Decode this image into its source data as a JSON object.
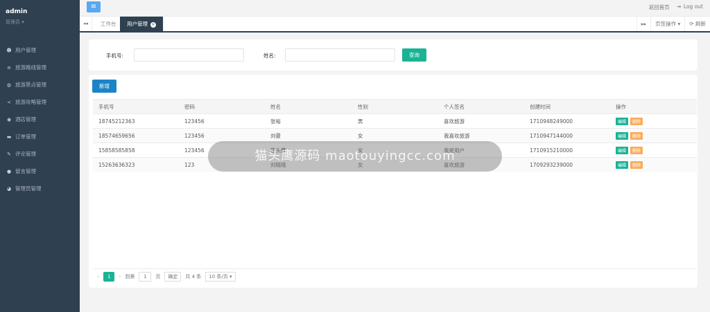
{
  "profile": {
    "name": "admin",
    "role": "管理员 ▾"
  },
  "sidebar": {
    "items": [
      {
        "label": "用户管理",
        "icon": "☻"
      },
      {
        "label": "旅游路线管理",
        "icon": "≡"
      },
      {
        "label": "旅游景点管理",
        "icon": "◍"
      },
      {
        "label": "旅游攻略管理",
        "icon": "<"
      },
      {
        "label": "酒店管理",
        "icon": "◉"
      },
      {
        "label": "订单管理",
        "icon": "▬"
      },
      {
        "label": "评论管理",
        "icon": "✎"
      },
      {
        "label": "留言管理",
        "icon": "●"
      },
      {
        "label": "管理员管理",
        "icon": "◕"
      }
    ]
  },
  "topbar": {
    "menu_icon": "≡",
    "home_link": "返回首页",
    "logout": "Log out",
    "logout_icon": "⇥"
  },
  "tabs": {
    "left_arrow": "◂◂",
    "right_arrow": "▸▸",
    "items": [
      {
        "label": "工作台"
      },
      {
        "label": "用户管理"
      }
    ],
    "close": "×",
    "page_ops": "页签操作 ▾",
    "refresh": "⟳ 刷新"
  },
  "search": {
    "phone_label": "手机号:",
    "phone_value": "",
    "name_label": "姓名:",
    "name_value": "",
    "query_button": "查询"
  },
  "table": {
    "add_button": "新增",
    "columns": [
      "手机号",
      "密码",
      "姓名",
      "性别",
      "个人签名",
      "创建时间",
      "操作"
    ],
    "rows": [
      [
        "18745212363",
        "123456",
        "张裕",
        "男",
        "喜欢旅游",
        "1710948249000"
      ],
      [
        "18574659656",
        "123456",
        "刘曼",
        "女",
        "我喜欢旅游",
        "1710947144000"
      ],
      [
        "15858585858",
        "123456",
        "猫头鹰",
        "女",
        "我是用户",
        "1710915210000"
      ],
      [
        "15263636323",
        "123",
        "刘晓晓",
        "女",
        "喜欢旅游",
        "1709293239000"
      ]
    ],
    "edit_label": "编辑",
    "delete_label": "删除"
  },
  "pager": {
    "prev": "‹",
    "current": "1",
    "next": "›",
    "goto": "到第",
    "goto_value": "1",
    "page_unit": "页",
    "confirm": "确定",
    "total": "共 4 条",
    "page_size": "10 条/页 ▾"
  },
  "watermark": {
    "text": "猫头鹰源码 maotouyingcc.com"
  }
}
